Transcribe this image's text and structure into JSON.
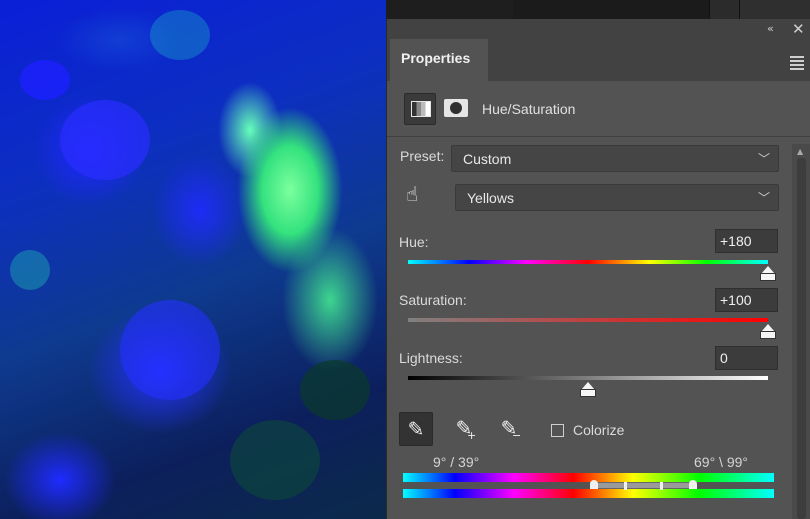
{
  "panel": {
    "tab_label": "Properties",
    "adjustment_title": "Hue/Saturation",
    "preset_label": "Preset:",
    "preset_value": "Custom",
    "channel_value": "Yellows",
    "hue_label": "Hue:",
    "hue_value": "+180",
    "saturation_label": "Saturation:",
    "saturation_value": "+100",
    "lightness_label": "Lightness:",
    "lightness_value": "0",
    "colorize_label": "Colorize",
    "range_left": "9° /  39°",
    "range_right": "69° \\  99°"
  },
  "sliders": {
    "hue": {
      "min": -180,
      "max": 180,
      "value": 180
    },
    "saturation": {
      "min": -100,
      "max": 100,
      "value": 100
    },
    "lightness": {
      "min": -100,
      "max": 100,
      "value": 0
    }
  },
  "icons": {
    "collapse": "double-chevron-left-icon",
    "close": "close-icon",
    "menu": "panel-menu-icon",
    "adjustment": "hue-saturation-icon",
    "mask": "layer-mask-icon",
    "targeted_adjust": "hand-targeted-adjustment-icon",
    "eyedroppers": [
      "eyedropper-icon",
      "eyedropper-add-icon",
      "eyedropper-subtract-icon"
    ]
  },
  "colors": {
    "panel_bg": "#535353",
    "tab_strip": "#424242",
    "input_bg": "#3c3c3c"
  }
}
